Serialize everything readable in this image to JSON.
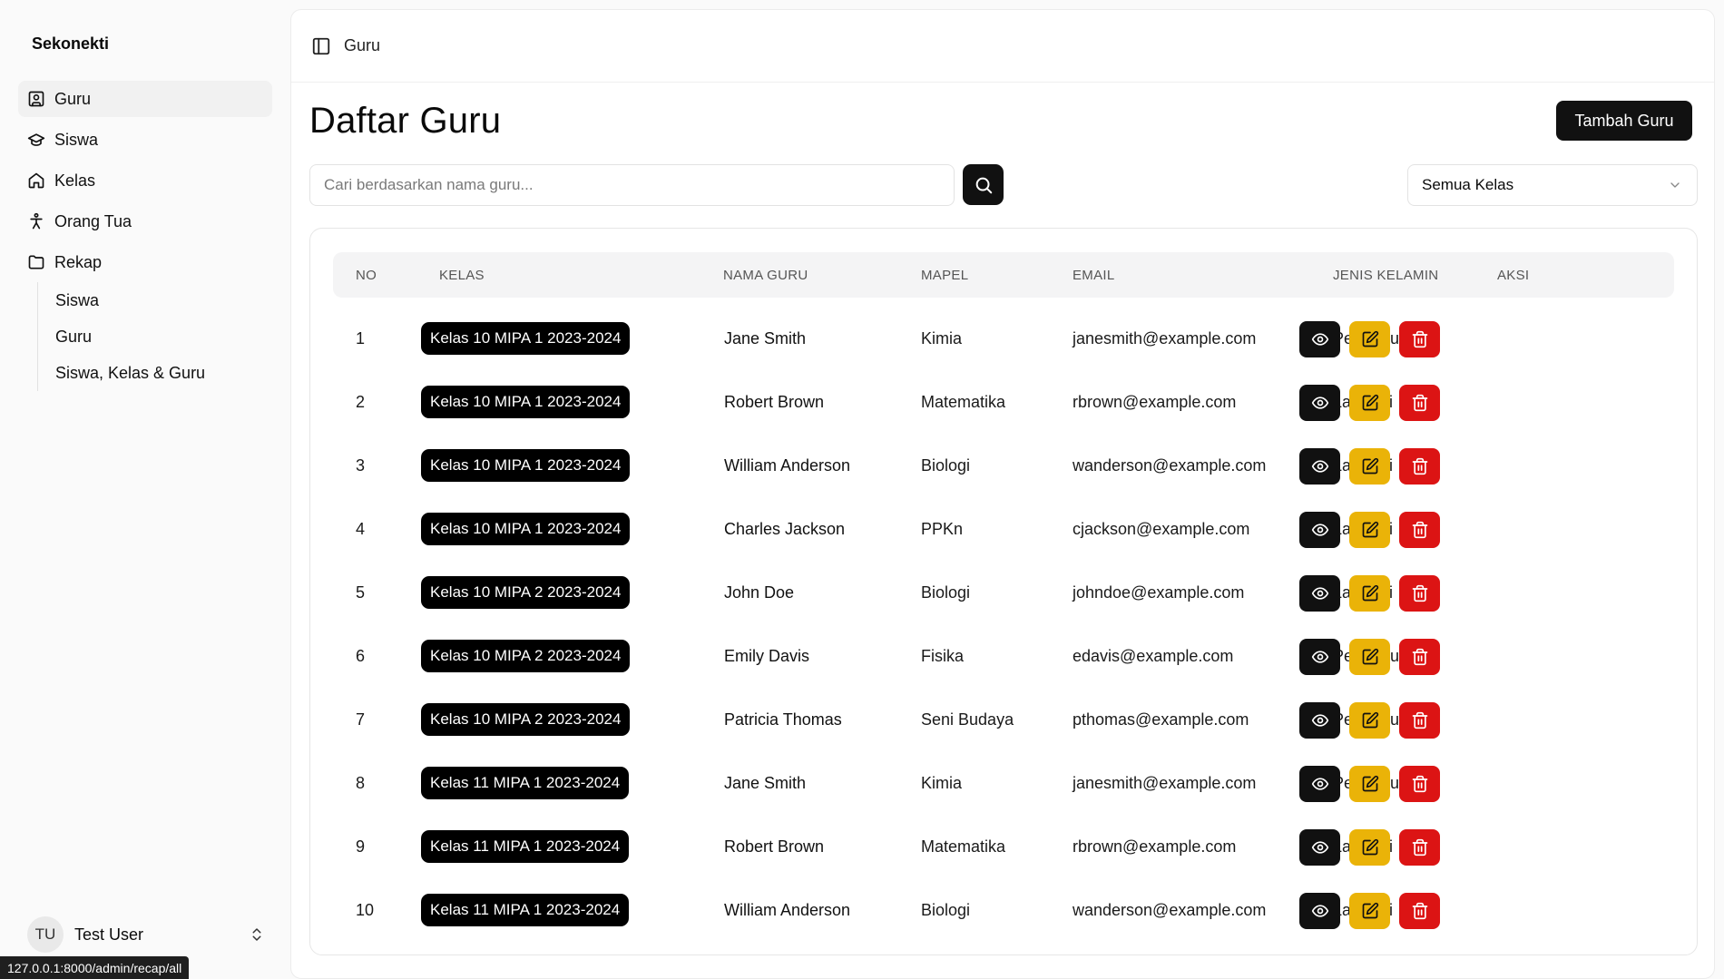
{
  "sidebar": {
    "brand": "Sekonekti",
    "items": [
      {
        "label": "Guru",
        "icon": "user-square-icon",
        "active": true
      },
      {
        "label": "Siswa",
        "icon": "graduation-cap-icon"
      },
      {
        "label": "Kelas",
        "icon": "house-icon"
      },
      {
        "label": "Orang Tua",
        "icon": "person-icon"
      },
      {
        "label": "Rekap",
        "icon": "folder-icon"
      }
    ],
    "rekap_sub": [
      "Siswa",
      "Guru",
      "Siswa, Kelas & Guru"
    ],
    "user": {
      "initials": "TU",
      "name": "Test User"
    }
  },
  "status_url": "127.0.0.1:8000/admin/recap/all",
  "header": {
    "breadcrumb": "Guru"
  },
  "page": {
    "title": "Daftar Guru",
    "add_button": "Tambah Guru",
    "search_placeholder": "Cari berdasarkan nama guru...",
    "class_filter": "Semua Kelas"
  },
  "table": {
    "columns": [
      "NO",
      "KELAS",
      "NAMA GURU",
      "MAPEL",
      "EMAIL",
      "JENIS KELAMIN",
      "AKSI"
    ],
    "rows": [
      {
        "no": "1",
        "kelas": "Kelas 10 MIPA 1 2023-2024",
        "nama": "Jane Smith",
        "mapel": "Kimia",
        "email": "janesmith@example.com",
        "jk": "Perempuan"
      },
      {
        "no": "2",
        "kelas": "Kelas 10 MIPA 1 2023-2024",
        "nama": "Robert Brown",
        "mapel": "Matematika",
        "email": "rbrown@example.com",
        "jk": "Laki-laki"
      },
      {
        "no": "3",
        "kelas": "Kelas 10 MIPA 1 2023-2024",
        "nama": "William Anderson",
        "mapel": "Biologi",
        "email": "wanderson@example.com",
        "jk": "Laki-laki"
      },
      {
        "no": "4",
        "kelas": "Kelas 10 MIPA 1 2023-2024",
        "nama": "Charles Jackson",
        "mapel": "PPKn",
        "email": "cjackson@example.com",
        "jk": "Laki-laki"
      },
      {
        "no": "5",
        "kelas": "Kelas 10 MIPA 2 2023-2024",
        "nama": "John Doe",
        "mapel": "Biologi",
        "email": "johndoe@example.com",
        "jk": "Laki-laki"
      },
      {
        "no": "6",
        "kelas": "Kelas 10 MIPA 2 2023-2024",
        "nama": "Emily Davis",
        "mapel": "Fisika",
        "email": "edavis@example.com",
        "jk": "Perempuan"
      },
      {
        "no": "7",
        "kelas": "Kelas 10 MIPA 2 2023-2024",
        "nama": "Patricia Thomas",
        "mapel": "Seni Budaya",
        "email": "pthomas@example.com",
        "jk": "Perempuan"
      },
      {
        "no": "8",
        "kelas": "Kelas 11 MIPA 1 2023-2024",
        "nama": "Jane Smith",
        "mapel": "Kimia",
        "email": "janesmith@example.com",
        "jk": "Perempuan"
      },
      {
        "no": "9",
        "kelas": "Kelas 11 MIPA 1 2023-2024",
        "nama": "Robert Brown",
        "mapel": "Matematika",
        "email": "rbrown@example.com",
        "jk": "Laki-laki"
      },
      {
        "no": "10",
        "kelas": "Kelas 11 MIPA 1 2023-2024",
        "nama": "William Anderson",
        "mapel": "Biologi",
        "email": "wanderson@example.com",
        "jk": "Laki-laki"
      }
    ],
    "action_icons": [
      "eye-icon",
      "edit-icon",
      "trash-icon"
    ]
  },
  "colors": {
    "primary": "#111111",
    "edit": "#eab308",
    "delete": "#dc1414"
  }
}
